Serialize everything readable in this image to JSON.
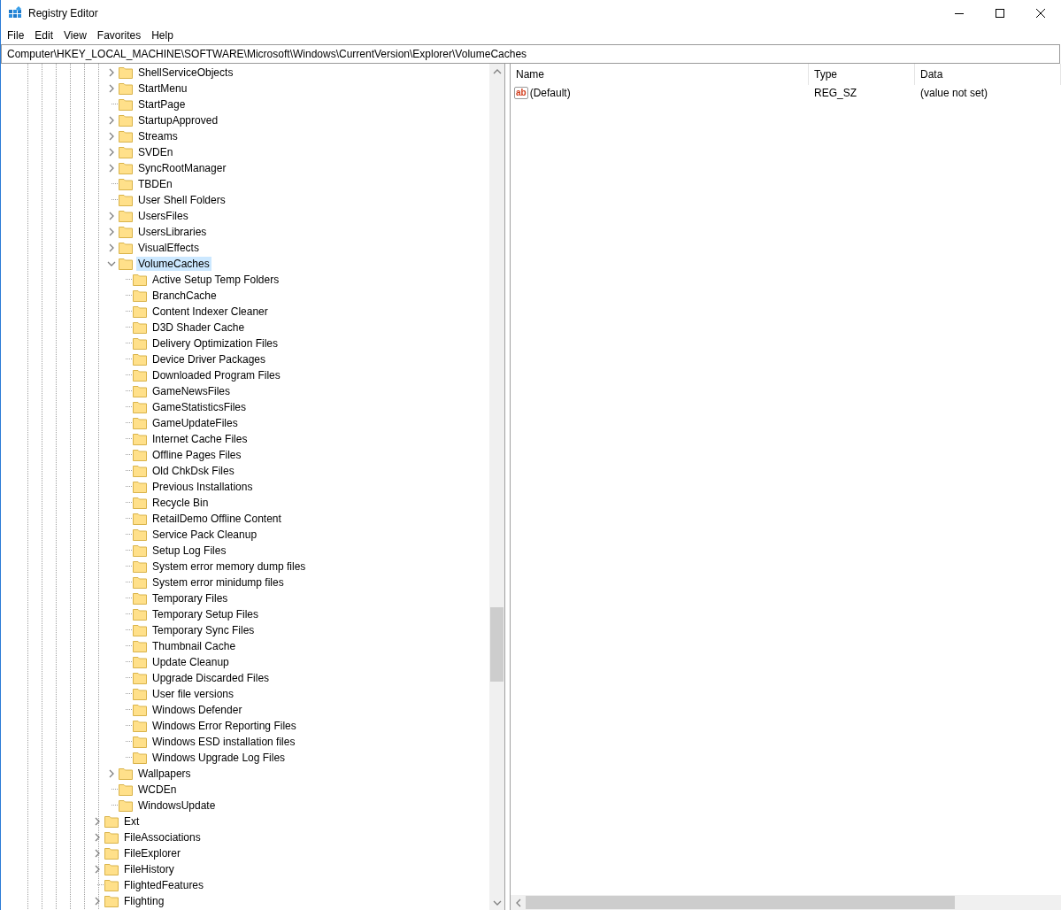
{
  "window": {
    "title": "Registry Editor"
  },
  "menu": [
    "File",
    "Edit",
    "View",
    "Favorites",
    "Help"
  ],
  "address": "Computer\\HKEY_LOCAL_MACHINE\\SOFTWARE\\Microsoft\\Windows\\CurrentVersion\\Explorer\\VolumeCaches",
  "tree": {
    "scrolled_branch": {
      "children": [
        {
          "label": "ShellServiceObjects",
          "kind": "branch",
          "expanded": false,
          "selected": false
        },
        {
          "label": "StartMenu",
          "kind": "branch",
          "expanded": false,
          "selected": false
        },
        {
          "label": "StartPage",
          "kind": "leaf",
          "selected": false
        },
        {
          "label": "StartupApproved",
          "kind": "branch",
          "expanded": false,
          "selected": false
        },
        {
          "label": "Streams",
          "kind": "branch",
          "expanded": false,
          "selected": false
        },
        {
          "label": "SVDEn",
          "kind": "branch",
          "expanded": false,
          "selected": false
        },
        {
          "label": "SyncRootManager",
          "kind": "branch",
          "expanded": false,
          "selected": false
        },
        {
          "label": "TBDEn",
          "kind": "leaf",
          "selected": false
        },
        {
          "label": "User Shell Folders",
          "kind": "leaf",
          "selected": false
        },
        {
          "label": "UsersFiles",
          "kind": "branch",
          "expanded": false,
          "selected": false
        },
        {
          "label": "UsersLibraries",
          "kind": "branch",
          "expanded": false,
          "selected": false
        },
        {
          "label": "VisualEffects",
          "kind": "branch",
          "expanded": false,
          "selected": false
        },
        {
          "label": "VolumeCaches",
          "kind": "branch",
          "expanded": true,
          "selected": true,
          "children": [
            {
              "label": "Active Setup Temp Folders",
              "kind": "leaf",
              "selected": false
            },
            {
              "label": "BranchCache",
              "kind": "leaf",
              "selected": false
            },
            {
              "label": "Content Indexer Cleaner",
              "kind": "leaf",
              "selected": false
            },
            {
              "label": "D3D Shader Cache",
              "kind": "leaf",
              "selected": false
            },
            {
              "label": "Delivery Optimization Files",
              "kind": "leaf",
              "selected": false
            },
            {
              "label": "Device Driver Packages",
              "kind": "leaf",
              "selected": false
            },
            {
              "label": "Downloaded Program Files",
              "kind": "leaf",
              "selected": false
            },
            {
              "label": "GameNewsFiles",
              "kind": "leaf",
              "selected": false
            },
            {
              "label": "GameStatisticsFiles",
              "kind": "leaf",
              "selected": false
            },
            {
              "label": "GameUpdateFiles",
              "kind": "leaf",
              "selected": false
            },
            {
              "label": "Internet Cache Files",
              "kind": "leaf",
              "selected": false
            },
            {
              "label": "Offline Pages Files",
              "kind": "leaf",
              "selected": false
            },
            {
              "label": "Old ChkDsk Files",
              "kind": "leaf",
              "selected": false
            },
            {
              "label": "Previous Installations",
              "kind": "leaf",
              "selected": false
            },
            {
              "label": "Recycle Bin",
              "kind": "leaf",
              "selected": false
            },
            {
              "label": "RetailDemo Offline Content",
              "kind": "leaf",
              "selected": false
            },
            {
              "label": "Service Pack Cleanup",
              "kind": "leaf",
              "selected": false
            },
            {
              "label": "Setup Log Files",
              "kind": "leaf",
              "selected": false
            },
            {
              "label": "System error memory dump files",
              "kind": "leaf",
              "selected": false
            },
            {
              "label": "System error minidump files",
              "kind": "leaf",
              "selected": false
            },
            {
              "label": "Temporary Files",
              "kind": "leaf",
              "selected": false
            },
            {
              "label": "Temporary Setup Files",
              "kind": "leaf",
              "selected": false
            },
            {
              "label": "Temporary Sync Files",
              "kind": "leaf",
              "selected": false
            },
            {
              "label": "Thumbnail Cache",
              "kind": "leaf",
              "selected": false
            },
            {
              "label": "Update Cleanup",
              "kind": "leaf",
              "selected": false
            },
            {
              "label": "Upgrade Discarded Files",
              "kind": "leaf",
              "selected": false
            },
            {
              "label": "User file versions",
              "kind": "leaf",
              "selected": false
            },
            {
              "label": "Windows Defender",
              "kind": "leaf",
              "selected": false
            },
            {
              "label": "Windows Error Reporting Files",
              "kind": "leaf",
              "selected": false
            },
            {
              "label": "Windows ESD installation files",
              "kind": "leaf",
              "selected": false
            },
            {
              "label": "Windows Upgrade Log Files",
              "kind": "leaf",
              "selected": false
            }
          ]
        },
        {
          "label": "Wallpapers",
          "kind": "branch",
          "expanded": false,
          "selected": false
        },
        {
          "label": "WCDEn",
          "kind": "leaf",
          "selected": false
        },
        {
          "label": "WindowsUpdate",
          "kind": "leaf",
          "selected": false
        }
      ]
    },
    "items": [
      {
        "label": "Ext",
        "kind": "branch",
        "expanded": false,
        "selected": false
      },
      {
        "label": "FileAssociations",
        "kind": "branch",
        "expanded": false,
        "selected": false
      },
      {
        "label": "FileExplorer",
        "kind": "branch",
        "expanded": false,
        "selected": false
      },
      {
        "label": "FileHistory",
        "kind": "branch",
        "expanded": false,
        "selected": false
      },
      {
        "label": "FlightedFeatures",
        "kind": "leaf",
        "selected": false
      },
      {
        "label": "Flighting",
        "kind": "branch",
        "expanded": false,
        "selected": false
      }
    ]
  },
  "values": {
    "columns": [
      "Name",
      "Type",
      "Data"
    ],
    "rows": [
      {
        "icon_text": "ab",
        "name": "(Default)",
        "type": "REG_SZ",
        "data": "(value not set)"
      }
    ]
  }
}
